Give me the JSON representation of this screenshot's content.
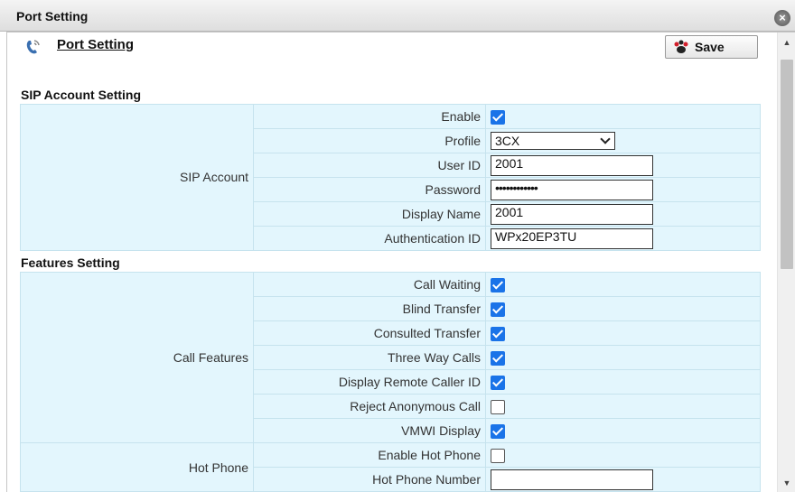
{
  "window": {
    "title": "Port Setting"
  },
  "page": {
    "title": "Port Setting",
    "save_label": "Save"
  },
  "sip_section": {
    "heading": "SIP Account Setting",
    "group_label": "SIP Account",
    "rows": {
      "enable": {
        "label": "Enable",
        "checked": true
      },
      "profile": {
        "label": "Profile",
        "value": "3CX"
      },
      "user_id": {
        "label": "User ID",
        "value": "2001"
      },
      "password": {
        "label": "Password",
        "value": "••••••••••••"
      },
      "display_name": {
        "label": "Display Name",
        "value": "2001"
      },
      "auth_id": {
        "label": "Authentication ID",
        "value": "WPx20EP3TU"
      }
    }
  },
  "features_section": {
    "heading": "Features Setting",
    "call_features_label": "Call Features",
    "call_features": [
      {
        "label": "Call Waiting",
        "checked": true
      },
      {
        "label": "Blind Transfer",
        "checked": true
      },
      {
        "label": "Consulted Transfer",
        "checked": true
      },
      {
        "label": "Three Way Calls",
        "checked": true
      },
      {
        "label": "Display Remote Caller ID",
        "checked": true
      },
      {
        "label": "Reject Anonymous Call",
        "checked": false
      },
      {
        "label": "VMWI Display",
        "checked": true
      }
    ],
    "hot_phone_label": "Hot Phone",
    "hot_phone": {
      "enable": {
        "label": "Enable Hot Phone",
        "checked": false
      },
      "number": {
        "label": "Hot Phone Number",
        "value": ""
      }
    }
  },
  "icons": {
    "close": "close-icon",
    "phone": "phone-icon",
    "save": "save-icon"
  },
  "colors": {
    "table_bg": "#e3f6fd",
    "checkbox_on": "#1a73e8"
  }
}
